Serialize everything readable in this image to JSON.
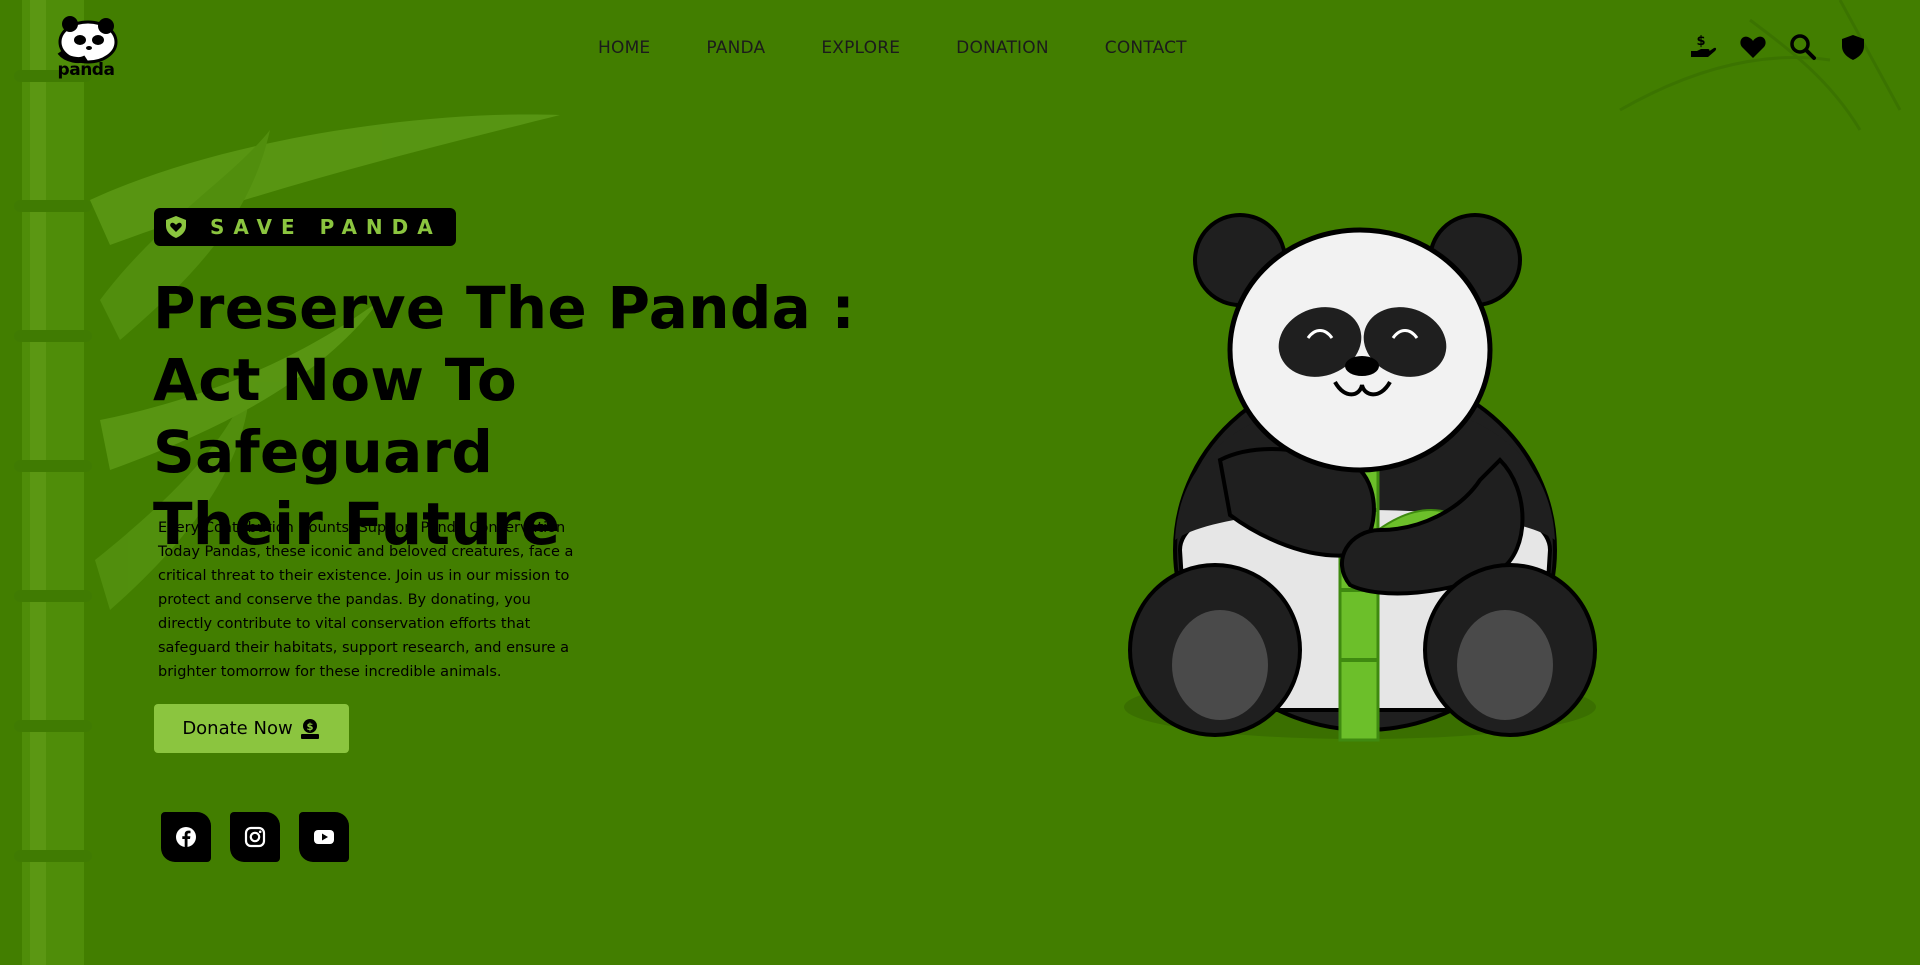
{
  "logo": {
    "text": "panda"
  },
  "nav": {
    "items": [
      {
        "label": "HOME"
      },
      {
        "label": "PANDA"
      },
      {
        "label": "EXPLORE"
      },
      {
        "label": "DONATION"
      },
      {
        "label": "CONTACT"
      }
    ]
  },
  "header_icons": [
    "donate-hand-icon",
    "heart-icon",
    "search-icon",
    "shield-icon"
  ],
  "hero": {
    "badge": "SAVE PANDA",
    "title_lines": [
      "Preserve The Panda :",
      "Act Now To Safeguard",
      "Their Future"
    ],
    "description": "Every Contribution Counts: Support Panda Conservation Today Pandas, these iconic and beloved creatures, face a critical threat to their existence. Join us in our mission to protect and conserve the pandas. By donating, you directly contribute to vital conservation efforts that safeguard their habitats, support research, and ensure a brighter tomorrow for these incredible animals.",
    "donate_button": "Donate Now"
  },
  "socials": [
    "facebook-icon",
    "instagram-icon",
    "youtube-icon"
  ],
  "colors": {
    "background": "#427e00",
    "accent": "#8bc53f",
    "text": "#000000"
  }
}
